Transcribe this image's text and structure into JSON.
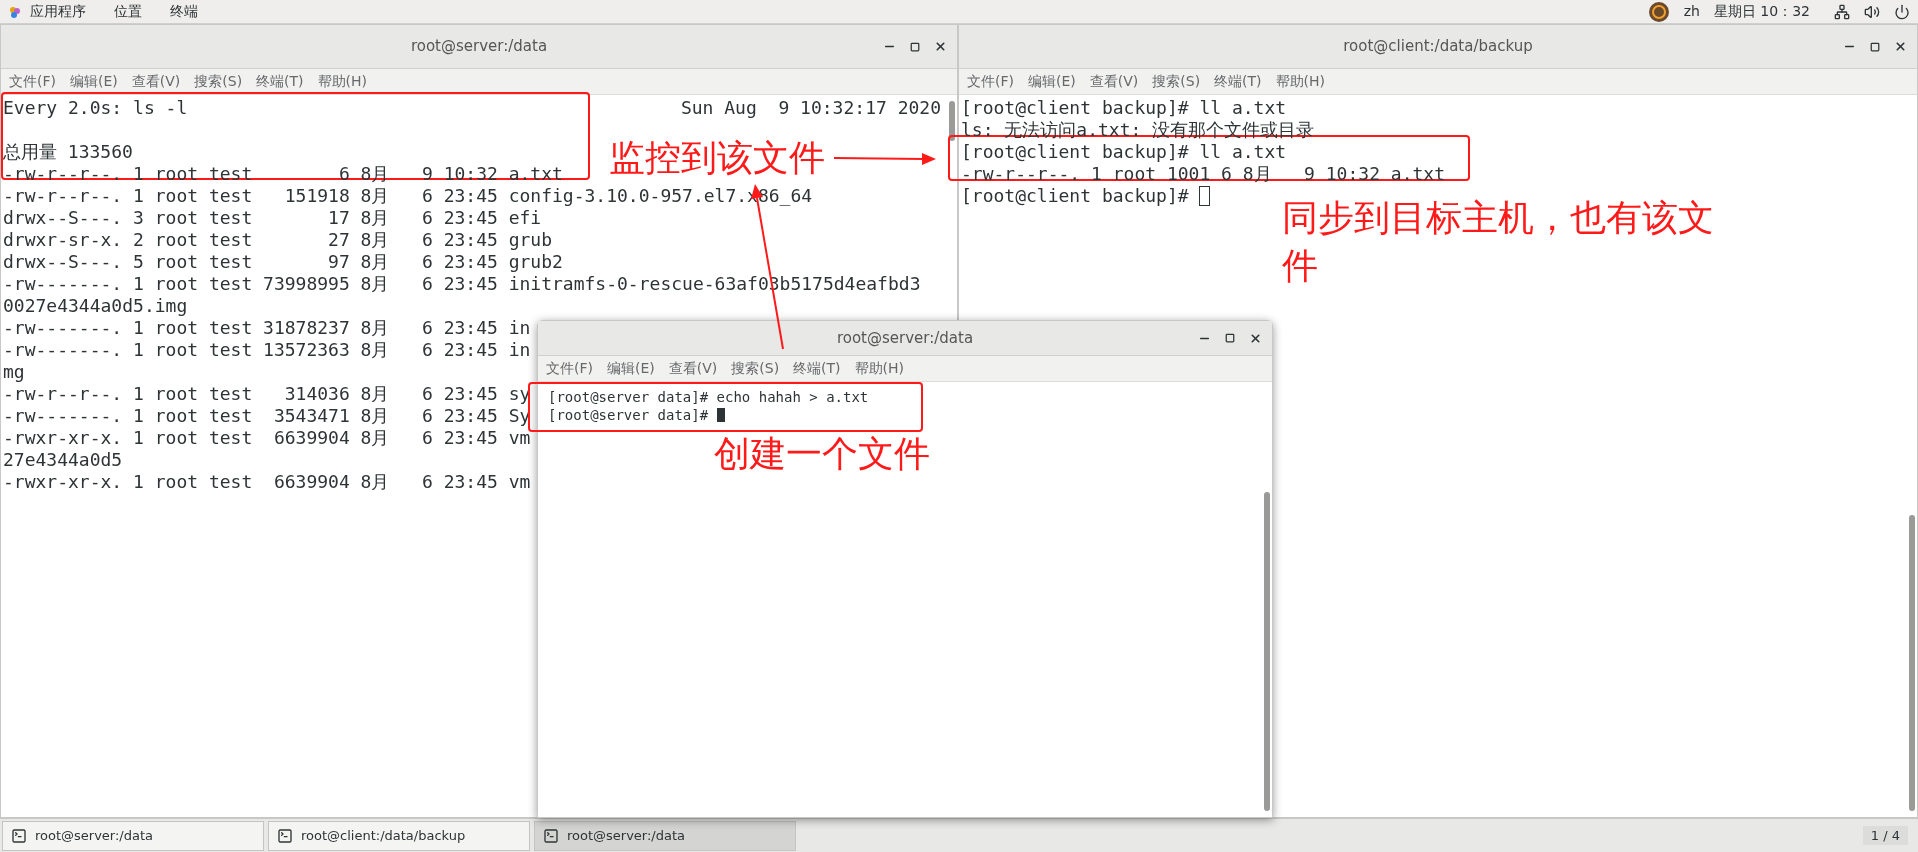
{
  "top_bar": {
    "menus": [
      "应用程序",
      "位置",
      "终端"
    ],
    "input_method": "zh",
    "clock": "星期日 10：32"
  },
  "windows": [
    {
      "title": "root@server:/data",
      "menu": [
        "文件(F)",
        "编辑(E)",
        "查看(V)",
        "搜索(S)",
        "终端(T)",
        "帮助(H)"
      ],
      "header": {
        "command": "Every 2.0s: ls -l",
        "timestamp": "Sun Aug  9 10:32:17 2020"
      },
      "lines": [
        "总用量 133560",
        "-rw-r--r--. 1 root test        6 8月   9 10:32 a.txt",
        "-rw-r--r--. 1 root test   151918 8月   6 23:45 config-3.10.0-957.el7.x86_64",
        "drwx--S---. 3 root test       17 8月   6 23:45 efi",
        "drwxr-sr-x. 2 root test       27 8月   6 23:45 grub",
        "drwx--S---. 5 root test       97 8月   6 23:45 grub2",
        "-rw-------. 1 root test 73998995 8月   6 23:45 initramfs-0-rescue-63af03b5175d4eafbd3",
        "0027e4344a0d5.img",
        "-rw-------. 1 root test 31878237 8月   6 23:45 in",
        "-rw-------. 1 root test 13572363 8月   6 23:45 in",
        "mg",
        "-rw-r--r--. 1 root test   314036 8月   6 23:45 sy",
        "-rw-------. 1 root test  3543471 8月   6 23:45 Sy",
        "-rwxr-xr-x. 1 root test  6639904 8月   6 23:45 vm",
        "27e4344a0d5",
        "-rwxr-xr-x. 1 root test  6639904 8月   6 23:45 vm"
      ]
    },
    {
      "title": "root@client:/data/backup",
      "menu": [
        "文件(F)",
        "编辑(E)",
        "查看(V)",
        "搜索(S)",
        "终端(T)",
        "帮助(H)"
      ],
      "lines": [
        "[root@client backup]# ll a.txt",
        "ls: 无法访问a.txt: 没有那个文件或目录",
        "[root@client backup]# ll a.txt",
        "-rw-r--r--. 1 root 1001 6 8月   9 10:32 a.txt",
        "[root@client backup]# "
      ],
      "cursor": {
        "filled": false
      }
    },
    {
      "title": "root@server:/data",
      "menu": [
        "文件(F)",
        "编辑(E)",
        "查看(V)",
        "搜索(S)",
        "终端(T)",
        "帮助(H)"
      ],
      "lines": [
        "[root@server data]# echo hahah > a.txt",
        "[root@server data]# "
      ],
      "cursor": {
        "filled": true
      }
    }
  ],
  "annotations": [
    {
      "text": "监控到该文件"
    },
    {
      "text": "创建一个文件"
    },
    {
      "text": "同步到目标主机，也有该文件"
    }
  ],
  "taskbar": {
    "items": [
      {
        "label": "root@server:/data",
        "selected": false
      },
      {
        "label": "root@client:/data/backup",
        "selected": false
      },
      {
        "label": "root@server:/data",
        "selected": true
      }
    ],
    "workspace": "1 / 4"
  }
}
